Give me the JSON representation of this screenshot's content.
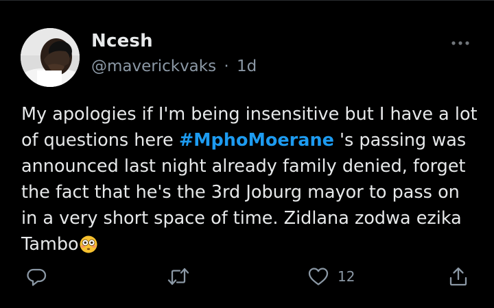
{
  "tweet": {
    "author": {
      "display_name": "Ncesh",
      "handle": "@maverickvaks",
      "separator": "·",
      "timestamp": "1d",
      "avatar_icon": "person-covering-face-avatar"
    },
    "text": {
      "line1": "My apologies if I'm being insensitive but I have a lot",
      "line2_before": "of questions here ",
      "hashtag": "#MphoMoerane",
      "line2_after": " 's passing was",
      "line3": "announced last night already family denied, forget",
      "line4": "the fact that he's the 3rd Joburg mayor to pass on",
      "line5": "in a very short space of time. Zidlana zodwa ezika",
      "line6": "Tambo",
      "emoji": "flushed-face-emoji"
    },
    "actions": {
      "reply_icon": "reply-icon",
      "retweet_icon": "retweet-icon",
      "like_icon": "heart-icon",
      "like_count": "12",
      "share_icon": "share-icon"
    },
    "colors": {
      "background": "#000000",
      "text": "#e7e9ea",
      "secondary": "#8b98a5",
      "hashtag": "#1d9bf0"
    }
  }
}
